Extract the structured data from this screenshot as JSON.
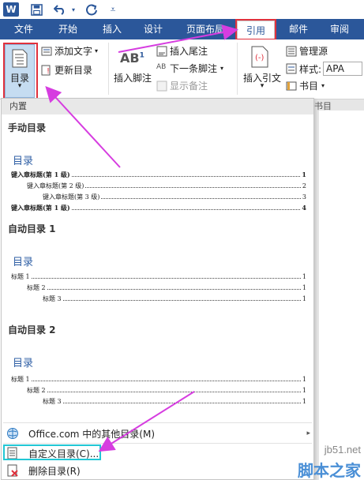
{
  "quick_access": {
    "logo": "W"
  },
  "tabs": [
    {
      "label": "文件"
    },
    {
      "label": "开始"
    },
    {
      "label": "插入"
    },
    {
      "label": "设计"
    },
    {
      "label": "页面布局"
    },
    {
      "label": "引用"
    },
    {
      "label": "邮件"
    },
    {
      "label": "审阅"
    }
  ],
  "ribbon": {
    "toc_label": "目录",
    "add_text": "添加文字",
    "update_toc": "更新目录",
    "footnote_icon": "AB",
    "footnote_sup": "1",
    "insert_footnote": "插入脚注",
    "insert_endnote": "插入尾注",
    "next_footnote": "下一条脚注",
    "show_notes": "显示备注",
    "insert_citation": "插入引文",
    "manage_sources": "管理源",
    "style_label": "样式:",
    "style_value": "APA",
    "bibliography": "书目",
    "group_label": "书目"
  },
  "menu": {
    "header": "内置",
    "manual": {
      "title": "手动目录",
      "toc_heading": "目录",
      "lines": [
        {
          "text": "键入章标题(第 1 级)",
          "page": "1"
        },
        {
          "text": "键入章标题(第 2 级)",
          "page": "2"
        },
        {
          "text": "键入章标题(第 3 级)",
          "page": "3"
        },
        {
          "text": "键入章标题(第 1 级)",
          "page": "4"
        }
      ]
    },
    "auto1": {
      "title": "自动目录 1",
      "toc_heading": "目录",
      "lines": [
        {
          "text": "标题 1",
          "page": "1"
        },
        {
          "text": "标题 2",
          "page": "1"
        },
        {
          "text": "标题 3",
          "page": "1"
        }
      ]
    },
    "auto2": {
      "title": "自动目录 2",
      "toc_heading": "目录",
      "lines": [
        {
          "text": "标题 1",
          "page": "1"
        },
        {
          "text": "标题 2",
          "page": "1"
        },
        {
          "text": "标题 3",
          "page": "1"
        }
      ]
    },
    "office_more": "Office.com 中的其他目录(M)",
    "custom_toc": "自定义目录(C)...",
    "remove_toc": "删除目录(R)"
  },
  "watermark": {
    "site": "jb51.net",
    "brand": "脚本之家"
  },
  "colors": {
    "accent": "#2b579a",
    "highlight_red": "#e0313d",
    "highlight_cyan": "#22c7d5",
    "arrow": "#d63de0",
    "toc_heading": "#2f5fa5"
  }
}
